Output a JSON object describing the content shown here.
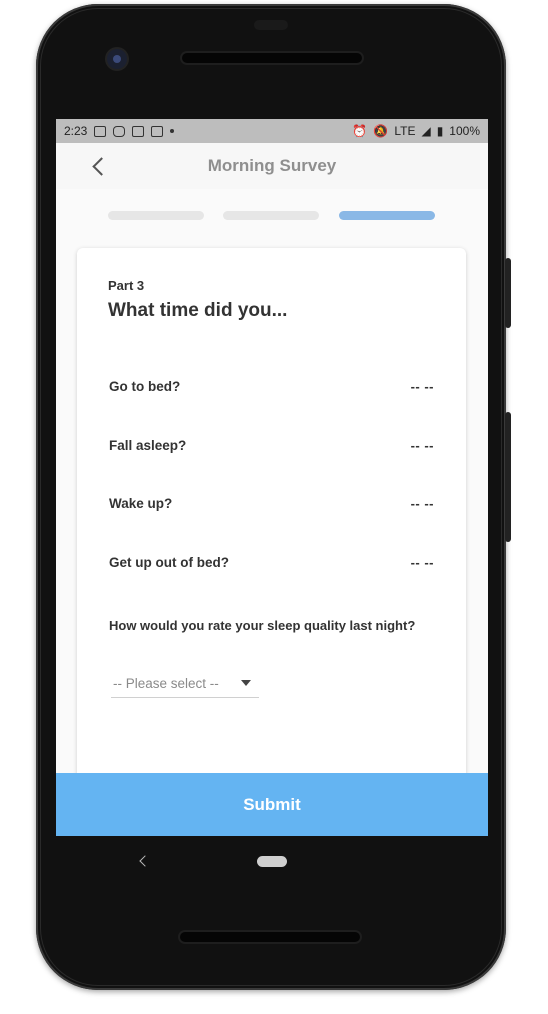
{
  "status_bar": {
    "time": "2:23",
    "network": "LTE",
    "battery": "100%",
    "icons": [
      "keyboard-icon",
      "instagram-icon",
      "app-icon",
      "app-icon",
      "dot-icon",
      "alarm-icon",
      "notifications-off-icon",
      "signal-icon",
      "battery-icon"
    ]
  },
  "app_bar": {
    "title": "Morning Survey",
    "back_icon": "chevron-left-icon"
  },
  "progress": {
    "steps": 3,
    "current_step": 3,
    "active_color": "#8ab8e6",
    "inactive_color": "#e6e6e6"
  },
  "survey": {
    "part_label": "Part 3",
    "heading": "What time did you...",
    "questions": [
      {
        "label": "Go to bed?",
        "value": "-- --"
      },
      {
        "label": "Fall asleep?",
        "value": "-- --"
      },
      {
        "label": "Wake up?",
        "value": "-- --"
      },
      {
        "label": "Get up out of bed?",
        "value": "-- --"
      }
    ],
    "rating_question": "How would you rate your sleep quality last night?",
    "rating_select": {
      "value": "-- Please select --"
    }
  },
  "submit": {
    "label": "Submit",
    "color": "#64b4f2"
  },
  "nav_bar": {
    "back_icon": "nav-back-icon",
    "home_icon": "nav-home-icon"
  }
}
